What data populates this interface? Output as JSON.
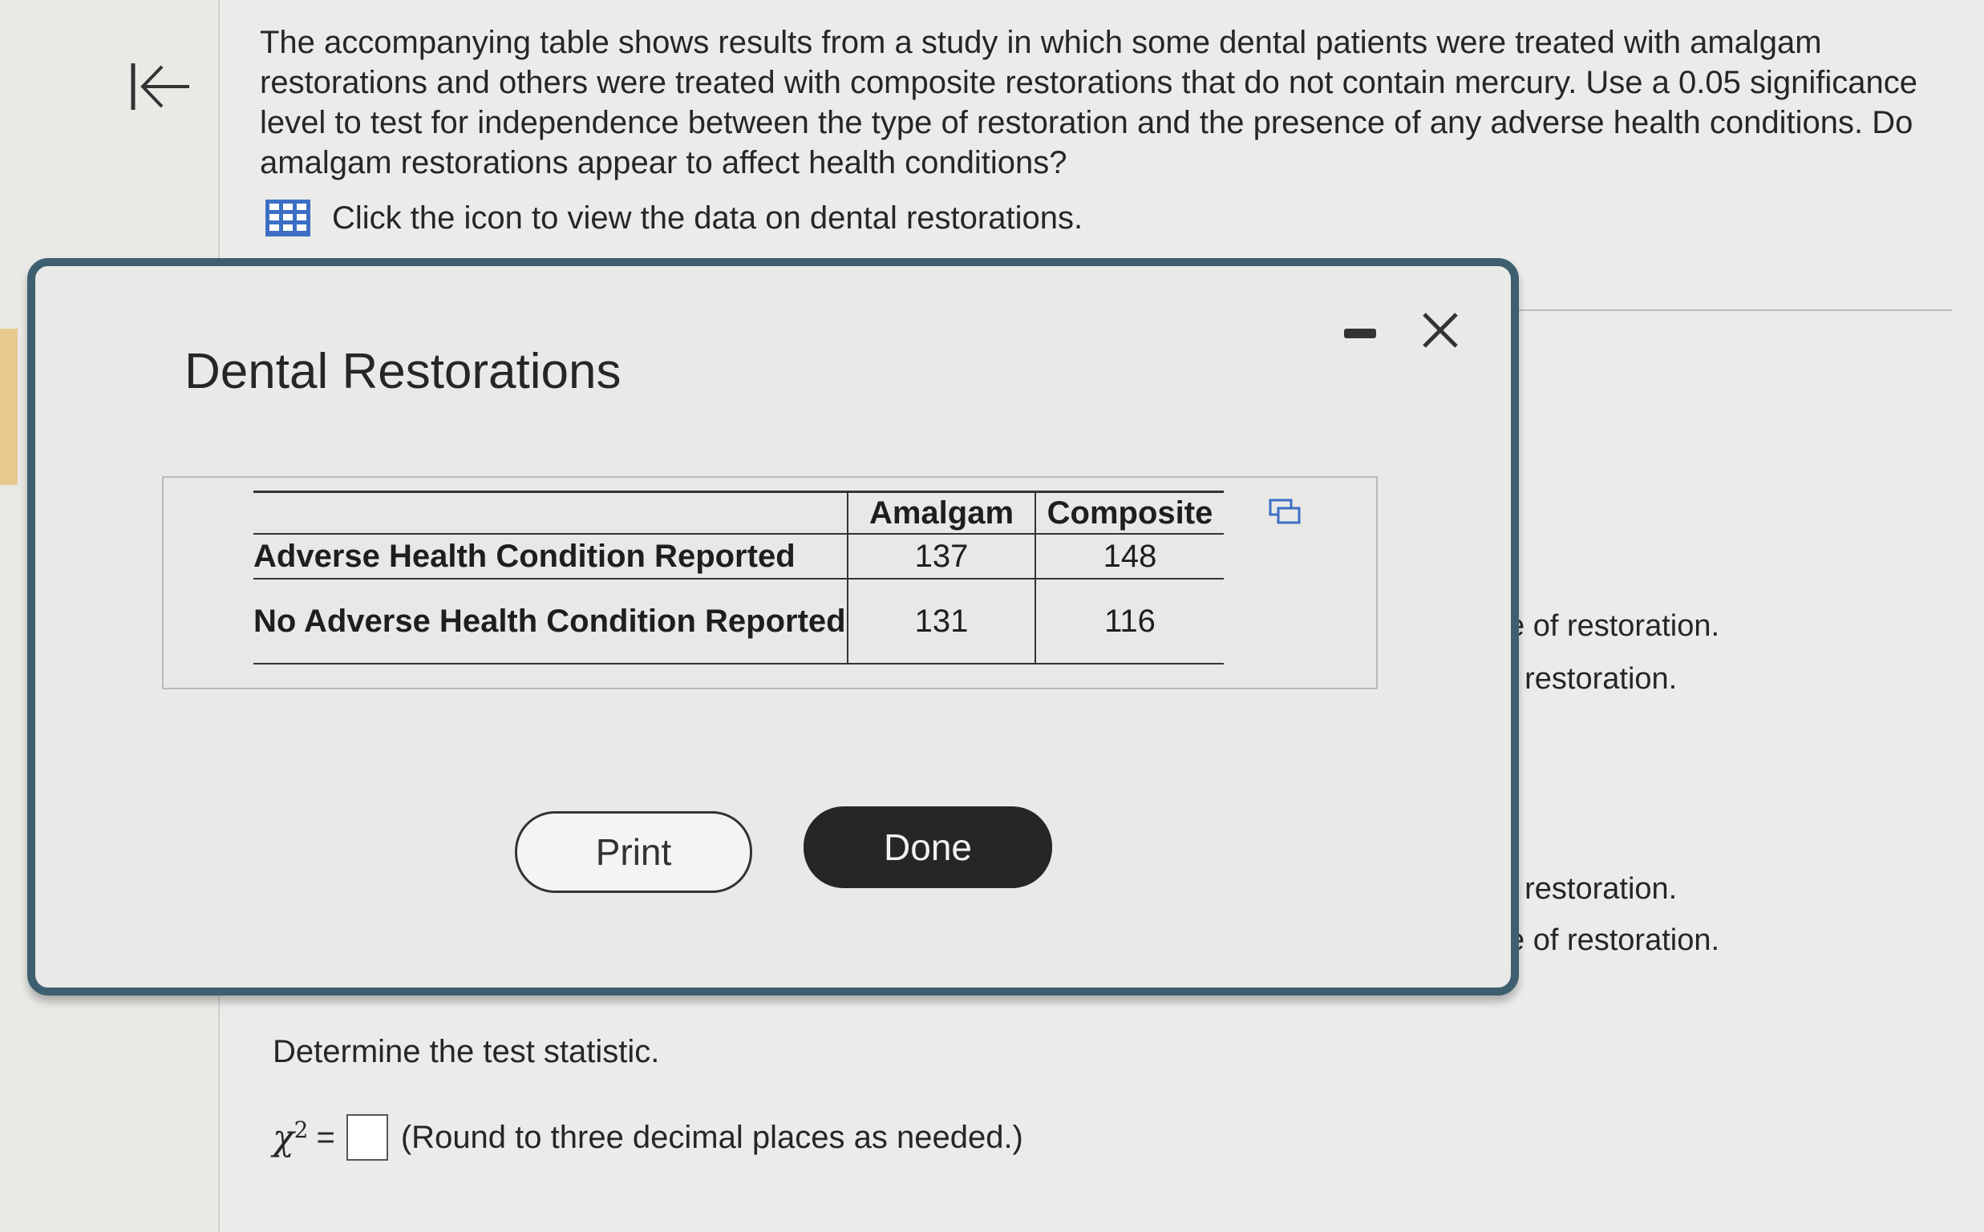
{
  "question": {
    "text": "The accompanying table shows results from a study in which some dental patients were treated with amalgam restorations and others were treated with composite restorations that do not contain mercury. Use a 0.05 significance level to test for independence between the type of restoration and the presence of any adverse health conditions. Do amalgam restorations appear to affect health conditions?",
    "data_link": "Click the icon to view the data on dental restorations."
  },
  "modal": {
    "title": "Dental Restorations",
    "table": {
      "columns": [
        "Amalgam",
        "Composite"
      ],
      "rows": [
        {
          "label": "Adverse Health Condition Reported",
          "values": [
            "137",
            "148"
          ]
        },
        {
          "label": "No Adverse Health Condition Reported",
          "values": [
            "131",
            "116"
          ]
        }
      ]
    },
    "print_label": "Print",
    "done_label": "Done"
  },
  "peek_text": [
    "e of restoration.",
    "f restoration.",
    "f restoration.",
    "e of restoration."
  ],
  "bottom": {
    "determine": "Determine the test statistic.",
    "chi_symbol": "χ",
    "chi_power": "2",
    "equals": "=",
    "round_note": "(Round to three decimal places as needed.)"
  },
  "colors": {
    "modal_border": "#3e5f6f",
    "done_button": "#262626",
    "grid_icon": "#3c6fc4"
  },
  "icons": [
    "back-arrow-icon",
    "grid-table-icon",
    "minimize-icon",
    "close-icon",
    "copy-icon"
  ]
}
